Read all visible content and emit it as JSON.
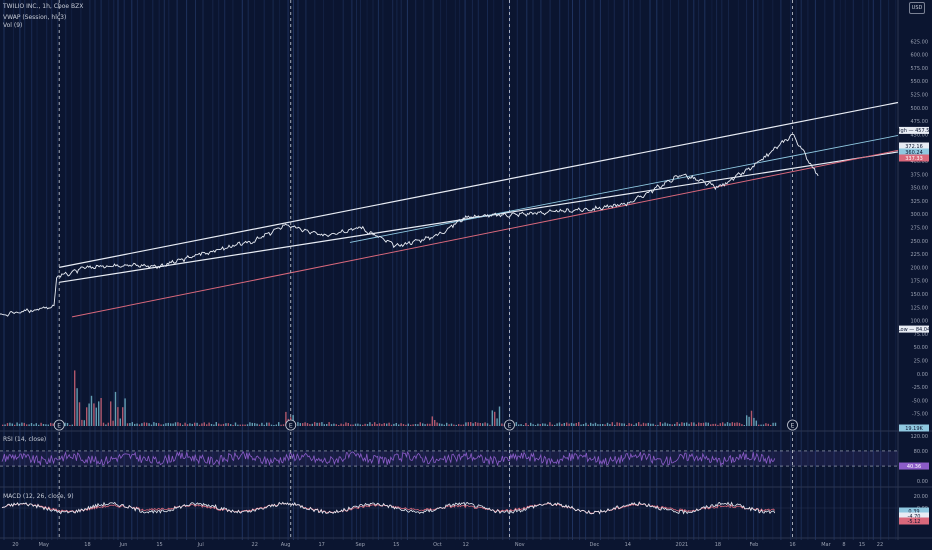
{
  "header": {
    "symbol_line": "TWILIO INC., 1h, Cboe BZX",
    "vwap_label": "VWAP (Session, hlc3)",
    "vol_label": "Vol (9)",
    "rsi_label": "RSI (14, close)",
    "macd_label": "MACD (12, 26, close, 9)",
    "currency": "USD"
  },
  "colors": {
    "background": "#0b1530",
    "price": "#e8ecf4",
    "channel": "#e8ecf4",
    "support": "#d9687b",
    "trendline": "#8fc8e0",
    "rsi": "#8b5cc8",
    "macd": "#e8ecf4",
    "signal": "#d9687b"
  },
  "chart_data": [
    {
      "type": "line",
      "name": "price",
      "yscale": "linear",
      "ylim": [
        -100,
        650
      ],
      "y_ticks": [
        "625.00",
        "600.00",
        "575.00",
        "550.00",
        "525.00",
        "500.00",
        "475.00",
        "450.00",
        "425.00",
        "400.00",
        "375.00",
        "350.00",
        "325.00",
        "300.00",
        "275.00",
        "250.00",
        "225.00",
        "200.00",
        "175.00",
        "150.00",
        "125.00",
        "100.00",
        "75.00",
        "50.00",
        "25.00",
        "0.00",
        "-25.00",
        "-50.00",
        "-75.00"
      ],
      "x_ticks": [
        "20",
        "May",
        "18",
        "Jun",
        "15",
        "Jul",
        "22",
        "Aug",
        "17",
        "Sep",
        "15",
        "Oct",
        "12",
        "Nov",
        "Dec",
        "14",
        "2021",
        "18",
        "Feb",
        "16",
        "Mar",
        "8",
        "15",
        "22"
      ],
      "x_tick_dates": [
        "2020-04-20",
        "2020-05-01",
        "2020-05-18",
        "2020-06-01",
        "2020-06-15",
        "2020-07-01",
        "2020-07-22",
        "2020-08-03",
        "2020-08-17",
        "2020-09-01",
        "2020-09-15",
        "2020-10-01",
        "2020-10-12",
        "2020-11-02",
        "2020-12-01",
        "2020-12-14",
        "2021-01-04",
        "2021-01-18",
        "2021-02-01",
        "2021-02-16",
        "2021-03-01",
        "2021-03-08",
        "2021-03-15",
        "2021-03-22"
      ],
      "series": [
        {
          "date": [
            "2020-04-14",
            "2020-04-20",
            "2020-04-27",
            "2020-05-05",
            "2020-05-06",
            "2020-05-08",
            "2020-05-18",
            "2020-06-01",
            "2020-06-15",
            "2020-07-01",
            "2020-07-22",
            "2020-08-03",
            "2020-08-17",
            "2020-09-01",
            "2020-09-15",
            "2020-10-01",
            "2020-10-12",
            "2020-11-02",
            "2020-12-01",
            "2020-12-14",
            "2021-01-04",
            "2021-01-18",
            "2021-02-01",
            "2021-02-16",
            "2021-02-26"
          ],
          "value": [
            110,
            115,
            120,
            128,
            180,
            185,
            200,
            205,
            202,
            225,
            250,
            280,
            260,
            275,
            240,
            260,
            295,
            300,
            310,
            320,
            375,
            350,
            390,
            450,
            372
          ]
        }
      ],
      "price_labels": [
        {
          "label": "High",
          "value": "457.50"
        },
        {
          "label": "",
          "value": "372.16"
        },
        {
          "label": "",
          "value": "360.24"
        },
        {
          "label": "",
          "value": "337.33"
        },
        {
          "label": "Low",
          "value": "84.04"
        },
        {
          "label": "",
          "value": "19.19K"
        }
      ],
      "earnings_markers": [
        "E",
        "E",
        "E",
        "E"
      ]
    },
    {
      "type": "line",
      "name": "RSI",
      "ylim": [
        -5,
        125
      ],
      "y_ticks": [
        "120.00",
        "80.00",
        "40.00",
        "0.00"
      ],
      "last_value": "40.36",
      "bands": [
        80,
        40
      ]
    },
    {
      "type": "line",
      "name": "MACD",
      "ylim": [
        -40,
        30
      ],
      "y_ticks": [
        "20.00",
        "0.00",
        "-20.00"
      ],
      "last_values": [
        "0.39",
        "-4.70",
        "-5.12"
      ]
    }
  ]
}
